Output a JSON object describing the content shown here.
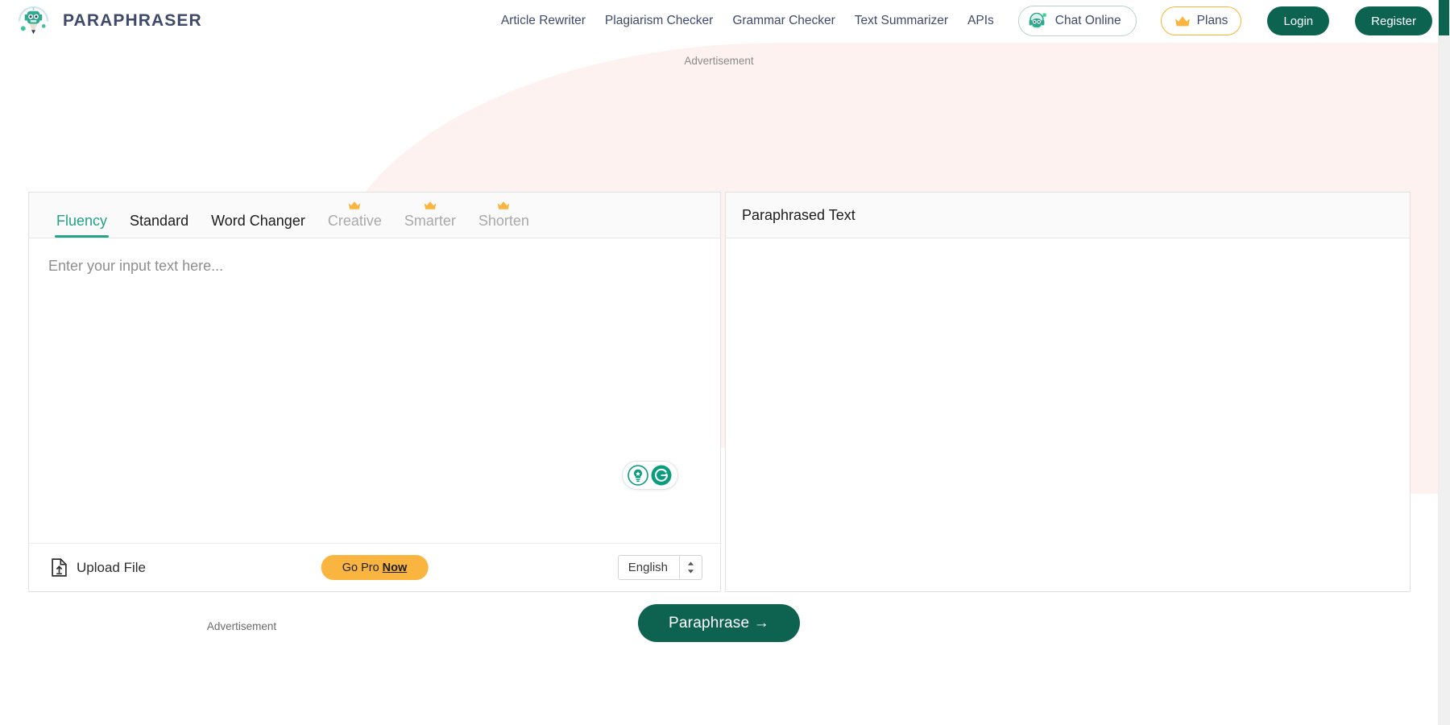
{
  "header": {
    "brand_name": "PARAPHRASER",
    "logo_icon": "robot-pencil-logo",
    "nav_links": [
      {
        "label": "Article Rewriter"
      },
      {
        "label": "Plagiarism Checker"
      },
      {
        "label": "Grammar Checker"
      },
      {
        "label": "Text Summarizer"
      },
      {
        "label": "APIs"
      }
    ],
    "chat": {
      "label": "Chat Online",
      "icon": "robot-headset-icon"
    },
    "plans": {
      "label": "Plans",
      "icon": "crown-icon"
    },
    "login_label": "Login",
    "register_label": "Register"
  },
  "ads": {
    "top_label": "Advertisement",
    "bottom_label": "Advertisement"
  },
  "editor": {
    "tabs": [
      {
        "label": "Fluency",
        "active": true,
        "locked": false
      },
      {
        "label": "Standard",
        "active": false,
        "locked": false
      },
      {
        "label": "Word Changer",
        "active": false,
        "locked": false
      },
      {
        "label": "Creative",
        "active": false,
        "locked": true
      },
      {
        "label": "Smarter",
        "active": false,
        "locked": true
      },
      {
        "label": "Shorten",
        "active": false,
        "locked": true
      }
    ],
    "input_placeholder": "Enter your input text here...",
    "input_value": "",
    "tools": [
      {
        "icon": "lightbulb-icon"
      },
      {
        "icon": "grammarly-refresh-icon"
      }
    ],
    "upload_label": "Upload File",
    "upload_icon": "file-upload-icon",
    "gopro_prefix": "Go Pro ",
    "gopro_emphasis": "Now",
    "language_value": "English",
    "language_options": [
      "English"
    ],
    "stepper_icon": "chevron-updown-icon"
  },
  "output": {
    "title": "Paraphrased Text",
    "body": ""
  },
  "cta": {
    "label": "Paraphrase →"
  },
  "colors": {
    "brand_navy": "#3f4a6b",
    "accent_green": "#0c6350",
    "tab_active": "#24a286",
    "gold": "#f9b53f",
    "blob_pink": "#fdf2ef"
  }
}
